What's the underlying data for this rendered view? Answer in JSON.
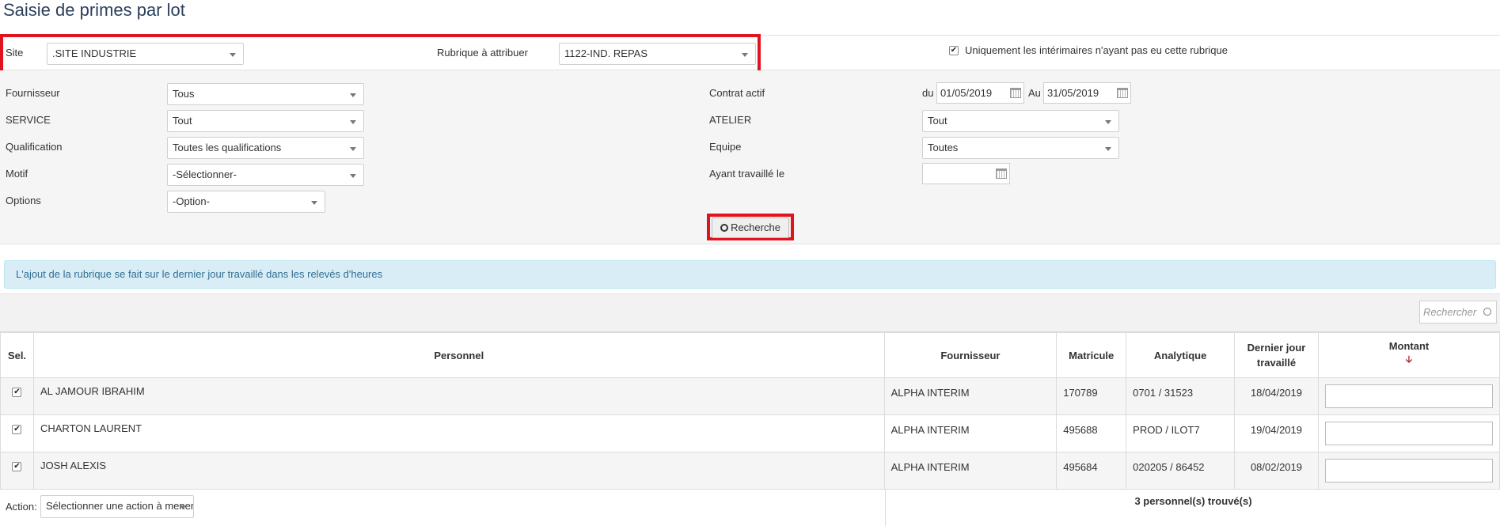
{
  "page": {
    "title": "Saisie de primes par lot"
  },
  "top_filters": {
    "site_label": "Site",
    "site_value": ".SITE INDUSTRIE",
    "rubrique_label": "Rubrique à attribuer",
    "rubrique_value": "1122-IND. REPAS",
    "only_interim_checked": true,
    "only_interim_label": "Uniquement les intérimaires n'ayant pas eu cette rubrique"
  },
  "filters": {
    "fournisseur_label": "Fournisseur",
    "fournisseur_value": "Tous",
    "service_label": "SERVICE",
    "service_value": "Tout",
    "qualification_label": "Qualification",
    "qualification_value": "Toutes les qualifications",
    "motif_label": "Motif",
    "motif_value": "-Sélectionner-",
    "options_label": "Options",
    "options_value": "-Option-",
    "contrat_label": "Contrat actif",
    "du_label": "du",
    "du_value": "01/05/2019",
    "au_label": "Au",
    "au_value": "31/05/2019",
    "atelier_label": "ATELIER",
    "atelier_value": "Tout",
    "equipe_label": "Equipe",
    "equipe_value": "Toutes",
    "travaille_label": "Ayant travaillé le",
    "travaille_value": "",
    "search_button": "Recherche"
  },
  "info_message": "L'ajout de la rubrique se fait sur le dernier jour travaillé dans les relevés d'heures",
  "table_search": {
    "placeholder": "Rechercher"
  },
  "table": {
    "headers": {
      "sel": "Sel.",
      "personnel": "Personnel",
      "fournisseur": "Fournisseur",
      "matricule": "Matricule",
      "analytique": "Analytique",
      "dernier_jour_1": "Dernier jour",
      "dernier_jour_2": "travaillé",
      "montant": "Montant"
    },
    "rows": [
      {
        "checked": true,
        "personnel": "AL JAMOUR IBRAHIM",
        "fournisseur": "ALPHA INTERIM",
        "matricule": "170789",
        "analytique": "0701 / 31523",
        "dernier_jour": "18/04/2019",
        "montant": ""
      },
      {
        "checked": true,
        "personnel": "CHARTON LAURENT",
        "fournisseur": "ALPHA INTERIM",
        "matricule": "495688",
        "analytique": "PROD / ILOT7",
        "dernier_jour": "19/04/2019",
        "montant": ""
      },
      {
        "checked": true,
        "personnel": "JOSH ALEXIS",
        "fournisseur": "ALPHA INTERIM",
        "matricule": "495684",
        "analytique": "020205 / 86452",
        "dernier_jour": "08/02/2019",
        "montant": ""
      }
    ]
  },
  "footer": {
    "action_label": "Action:",
    "action_value": "Sélectionner une action à mener",
    "count_text": "3 personnel(s) trouvé(s)"
  },
  "colors": {
    "highlight": "#e0141f",
    "title": "#2b3f5c",
    "info_bg": "#d9edf7",
    "info_text": "#31708f",
    "sort_arrow": "#aa1111"
  },
  "icons": [
    "dropdown-caret-icon",
    "calendar-icon",
    "search-icon",
    "checkbox-check-icon",
    "sort-down-arrow-icon"
  ]
}
